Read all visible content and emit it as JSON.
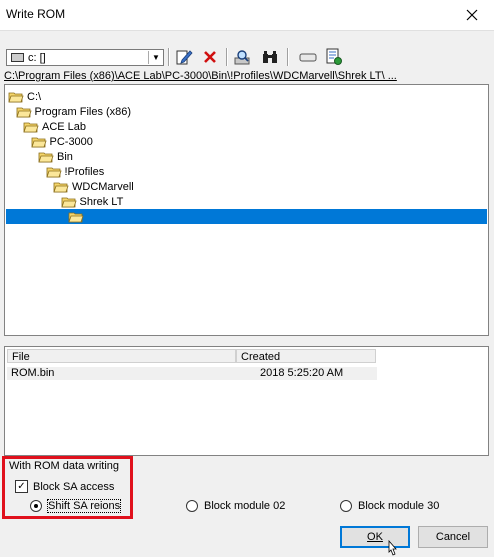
{
  "window": {
    "title": "Write ROM"
  },
  "toolbar": {
    "drive_value": "c: []",
    "icons": [
      "edit-icon",
      "delete-icon",
      "find-icon",
      "binoculars-icon",
      "eject-icon",
      "properties-icon"
    ]
  },
  "path": "C:\\Program Files (x86)\\ACE Lab\\PC-3000\\Bin\\!Profiles\\WDCMarvell\\Shrek LT\\ ...",
  "tree": [
    {
      "label": "C:\\",
      "level": 0,
      "open": true
    },
    {
      "label": "Program Files (x86)",
      "level": 1,
      "open": true
    },
    {
      "label": "ACE Lab",
      "level": 2,
      "open": true
    },
    {
      "label": "PC-3000",
      "level": 3,
      "open": true
    },
    {
      "label": "Bin",
      "level": 4,
      "open": true
    },
    {
      "label": "!Profiles",
      "level": 5,
      "open": true
    },
    {
      "label": "WDCMarvell",
      "level": 6,
      "open": true
    },
    {
      "label": "Shrek LT",
      "level": 7,
      "open": true
    },
    {
      "label": "",
      "level": 8,
      "open": true,
      "selected": true
    }
  ],
  "files": {
    "col_file": "File",
    "col_created": "Created",
    "rows": [
      {
        "name": "ROM.bin",
        "created": "2018 5:25:20 AM"
      }
    ]
  },
  "options": {
    "group_title": "With ROM data writing",
    "block_sa_label": "Block SA access",
    "block_sa_checked": true,
    "radios": [
      {
        "label": "Shift SA reions",
        "checked": true
      },
      {
        "label": "Block module 02",
        "checked": false
      },
      {
        "label": "Block module 30",
        "checked": false
      }
    ]
  },
  "buttons": {
    "ok": "OK",
    "cancel": "Cancel"
  },
  "colors": {
    "selection": "#0078d7",
    "highlight_box": "#e0101c"
  }
}
